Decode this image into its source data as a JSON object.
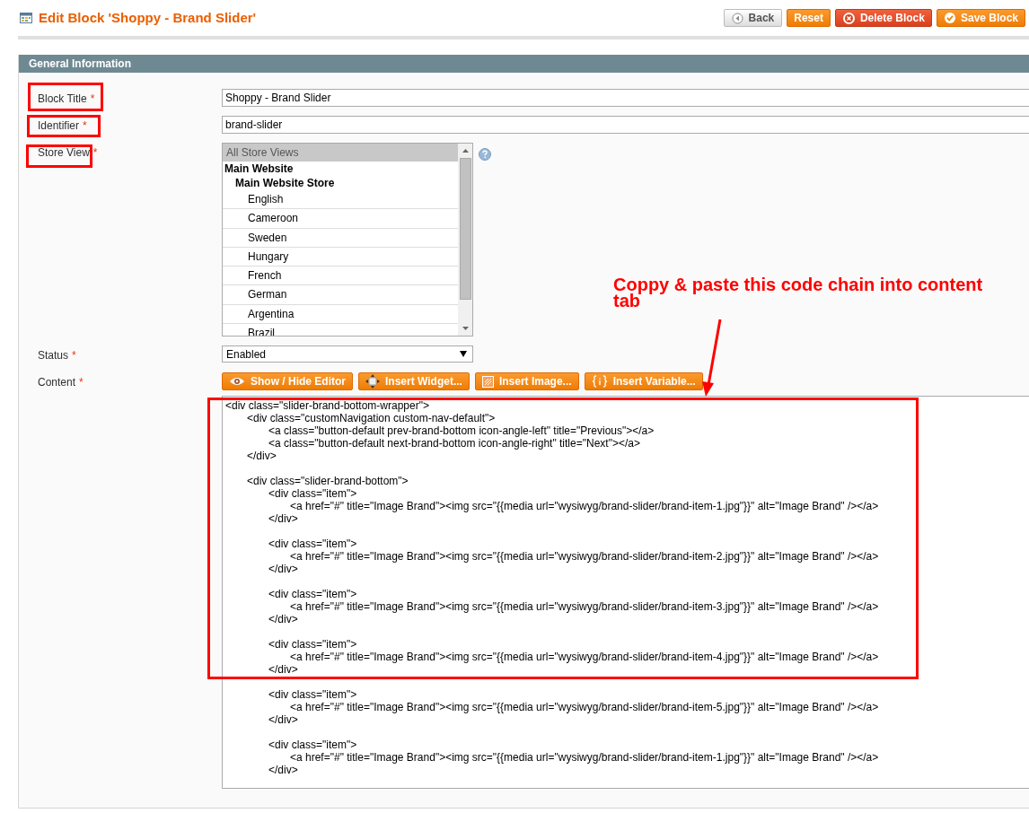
{
  "page_title": "Edit Block 'Shoppy - Brand Slider'",
  "actions": [
    {
      "label": "Back",
      "kind": "back"
    },
    {
      "label": "Reset",
      "kind": "reset"
    },
    {
      "label": "Delete Block",
      "kind": "delete"
    },
    {
      "label": "Save Block",
      "kind": "save"
    }
  ],
  "section": {
    "title": "General Information",
    "fields": [
      {
        "kind": "text",
        "label": "Block Title",
        "required_mark": "*",
        "value": "Shoppy - Brand Slider"
      },
      {
        "kind": "text",
        "label": "Identifier",
        "required_mark": "*",
        "value": "brand-slider"
      },
      {
        "kind": "multiselect",
        "label": "Store View",
        "required_mark": "*",
        "options": [
          {
            "label": "All Store Views",
            "kind": "option",
            "selected": true
          },
          {
            "label": "Main Website",
            "kind": "group",
            "children": [
              {
                "label": "Main Website Store",
                "kind": "group",
                "children": [
                  {
                    "label": "English",
                    "kind": "option",
                    "selected": false
                  },
                  {
                    "label": "Cameroon",
                    "kind": "option",
                    "selected": false
                  },
                  {
                    "label": "Sweden",
                    "kind": "option",
                    "selected": false
                  },
                  {
                    "label": "Hungary",
                    "kind": "option",
                    "selected": false
                  },
                  {
                    "label": "French",
                    "kind": "option",
                    "selected": false
                  },
                  {
                    "label": "German",
                    "kind": "option",
                    "selected": false
                  },
                  {
                    "label": "Argentina",
                    "kind": "option",
                    "selected": false
                  },
                  {
                    "label": "Brazil",
                    "kind": "option",
                    "selected": false
                  }
                ]
              }
            ]
          }
        ]
      },
      {
        "kind": "select",
        "label": "Status",
        "required_mark": "*",
        "value": "Enabled"
      },
      {
        "kind": "editor",
        "label": "Content",
        "required_mark": "*",
        "buttons": [
          {
            "label": "Show / Hide Editor",
            "kind": "eye"
          },
          {
            "label": "Insert Widget...",
            "kind": "widget"
          },
          {
            "label": "Insert Image...",
            "kind": "image"
          },
          {
            "label": "Insert Variable...",
            "kind": "variable"
          }
        ],
        "value": "<div class=\"slider-brand-bottom-wrapper\">\n\t<div class=\"customNavigation custom-nav-default\">\n\t\t<a class=\"button-default prev-brand-bottom icon-angle-left\" title=\"Previous\"></a>\n\t\t<a class=\"button-default next-brand-bottom icon-angle-right\" title=\"Next\"></a>\n\t</div>\n\n\t<div class=\"slider-brand-bottom\">\n\t\t<div class=\"item\">\n\t\t\t<a href=\"#\" title=\"Image Brand\"><img src=\"{{media url=\"wysiwyg/brand-slider/brand-item-1.jpg\"}}\" alt=\"Image Brand\" /></a>\n\t\t</div>\n\n\t\t<div class=\"item\">\n\t\t\t<a href=\"#\" title=\"Image Brand\"><img src=\"{{media url=\"wysiwyg/brand-slider/brand-item-2.jpg\"}}\" alt=\"Image Brand\" /></a>\n\t\t</div>\n\n\t\t<div class=\"item\">\n\t\t\t<a href=\"#\" title=\"Image Brand\"><img src=\"{{media url=\"wysiwyg/brand-slider/brand-item-3.jpg\"}}\" alt=\"Image Brand\" /></a>\n\t\t</div>\n\n\t\t<div class=\"item\">\n\t\t\t<a href=\"#\" title=\"Image Brand\"><img src=\"{{media url=\"wysiwyg/brand-slider/brand-item-4.jpg\"}}\" alt=\"Image Brand\" /></a>\n\t\t</div>\n\n\t\t<div class=\"item\">\n\t\t\t<a href=\"#\" title=\"Image Brand\"><img src=\"{{media url=\"wysiwyg/brand-slider/brand-item-5.jpg\"}}\" alt=\"Image Brand\" /></a>\n\t\t</div>\n\n\t\t<div class=\"item\">\n\t\t\t<a href=\"#\" title=\"Image Brand\"><img src=\"{{media url=\"wysiwyg/brand-slider/brand-item-1.jpg\"}}\" alt=\"Image Brand\" /></a>\n\t\t</div>"
      }
    ]
  },
  "annotation": {
    "text": "Coppy & paste this code chain into content tab"
  }
}
